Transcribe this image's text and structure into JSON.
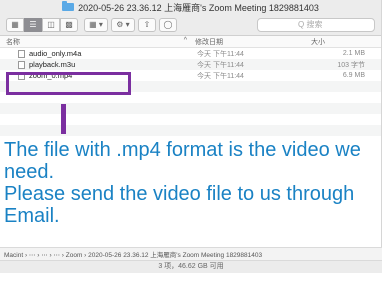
{
  "window": {
    "title": "2020-05-26 23.36.12 上海雁商's Zoom Meeting 1829881403"
  },
  "toolbar": {
    "view_icons": [
      "icon-view",
      "list-view",
      "column-view",
      "gallery-view"
    ],
    "search_placeholder": "Q 搜索"
  },
  "columns": {
    "name": "名称",
    "sort_indicator": "^",
    "date": "修改日期",
    "size": "大小"
  },
  "files": [
    {
      "name": "audio_only.m4a",
      "date": "今天 下午11:44",
      "size": "2.1 MB"
    },
    {
      "name": "playback.m3u",
      "date": "今天 下午11:44",
      "size": "103 字节"
    },
    {
      "name": "zoom_0.mp4",
      "date": "今天 下午11:44",
      "size": "6.9 MB"
    }
  ],
  "instruction": {
    "line1": "The file with .mp4 format is the video we need.",
    "line2": "Please send the video file  to us through Email."
  },
  "pathbar": {
    "text": "Macint › ⋯ › ⋯ › ⋯ › Zoom › 2020-05-26 23.36.12 上海雁商's Zoom Meeting 1829881403"
  },
  "statusbar": {
    "text": "3 项，46.62 GB 可用"
  },
  "colors": {
    "highlight": "#7b2fa0",
    "instruction_text": "#1a82c4"
  }
}
